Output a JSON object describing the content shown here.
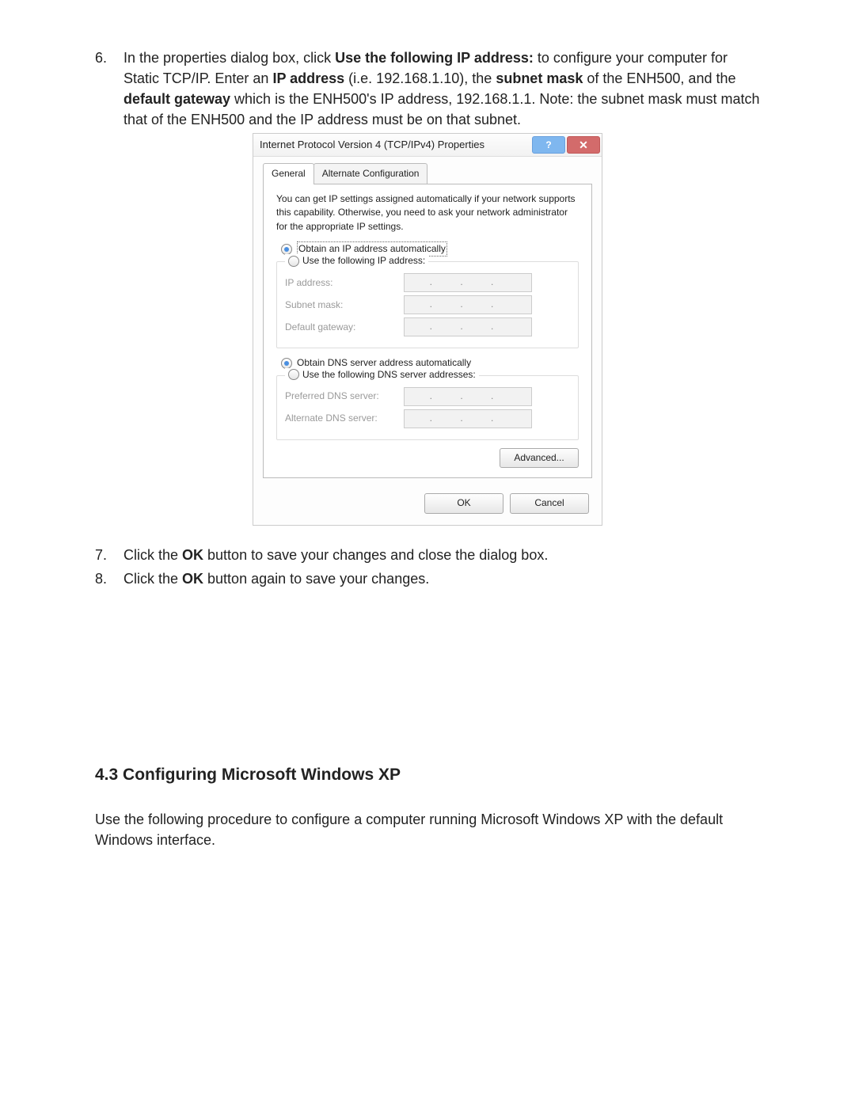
{
  "doc": {
    "step6_num": "6.",
    "step6_html_pieces": [
      "In the properties dialog box, click ",
      "Use the following IP address:",
      " to configure your computer for Static TCP/IP.   Enter an ",
      "IP address",
      " (i.e. 192.168.1.10), the ",
      "subnet mask",
      " of the ENH500, and the ",
      "default gateway",
      " which is the ENH500's IP address, 192.168.1.1.   Note: the subnet mask must match that of the ENH500 and the IP address must be on that subnet."
    ],
    "step7_num": "7.",
    "step7_pieces": [
      "Click the ",
      "OK",
      " button to save your changes and close the dialog box."
    ],
    "step8_num": "8.",
    "step8_pieces": [
      "Click the ",
      "OK",
      " button again to save your changes."
    ],
    "section_heading": "4.3 Configuring Microsoft Windows XP",
    "section_intro": "Use the following procedure to configure a computer running Microsoft Windows XP with the default Windows interface."
  },
  "dialog": {
    "title": "Internet Protocol Version 4 (TCP/IPv4) Properties",
    "help_glyph": "?",
    "close_glyph": "✕",
    "tabs": {
      "general": "General",
      "alt": "Alternate Configuration"
    },
    "desc": "You can get IP settings assigned automatically if your network supports this capability. Otherwise, you need to ask your network administrator for the appropriate IP settings.",
    "ip": {
      "auto": "Obtain an IP address automatically",
      "manual": "Use the following IP address:",
      "addr_label": "IP address:",
      "mask_label": "Subnet mask:",
      "gw_label": "Default gateway:"
    },
    "dns": {
      "auto": "Obtain DNS server address automatically",
      "manual": "Use the following DNS server addresses:",
      "pref_label": "Preferred DNS server:",
      "alt_label": "Alternate DNS server:"
    },
    "dots": ". . .",
    "advanced": "Advanced...",
    "ok": "OK",
    "cancel": "Cancel"
  }
}
